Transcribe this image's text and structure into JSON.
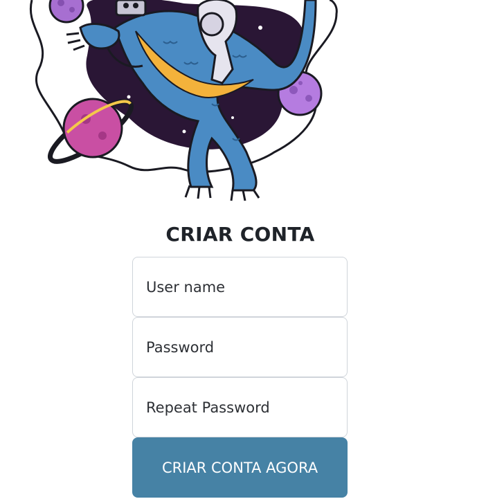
{
  "hero": {
    "image": "astronaut-riding-dinosaur-in-space-illustration"
  },
  "heading": {
    "title": "CRIAR CONTA"
  },
  "form": {
    "username_placeholder": "User name",
    "password_placeholder": "Password",
    "repeat_password_placeholder": "Repeat Password",
    "submit_label": "CRIAR CONTA AGORA"
  },
  "colors": {
    "button": "#4682a5",
    "heading": "#1f2329",
    "field_border": "#cfd4da"
  }
}
